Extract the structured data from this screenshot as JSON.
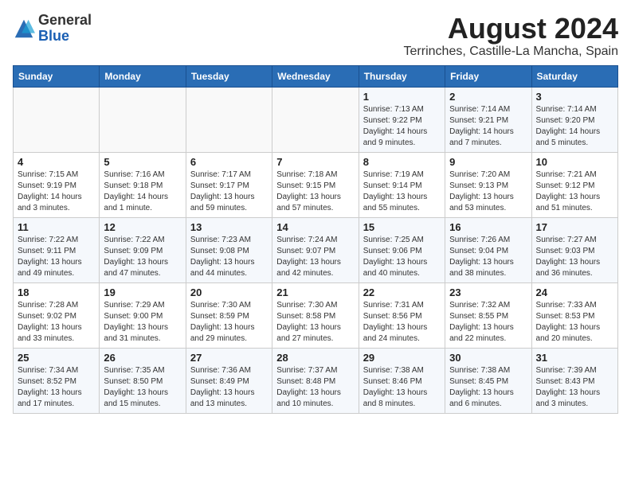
{
  "logo": {
    "general": "General",
    "blue": "Blue"
  },
  "title": "August 2024",
  "subtitle": "Terrinches, Castille-La Mancha, Spain",
  "headers": [
    "Sunday",
    "Monday",
    "Tuesday",
    "Wednesday",
    "Thursday",
    "Friday",
    "Saturday"
  ],
  "weeks": [
    [
      {
        "day": "",
        "info": ""
      },
      {
        "day": "",
        "info": ""
      },
      {
        "day": "",
        "info": ""
      },
      {
        "day": "",
        "info": ""
      },
      {
        "day": "1",
        "info": "Sunrise: 7:13 AM\nSunset: 9:22 PM\nDaylight: 14 hours\nand 9 minutes."
      },
      {
        "day": "2",
        "info": "Sunrise: 7:14 AM\nSunset: 9:21 PM\nDaylight: 14 hours\nand 7 minutes."
      },
      {
        "day": "3",
        "info": "Sunrise: 7:14 AM\nSunset: 9:20 PM\nDaylight: 14 hours\nand 5 minutes."
      }
    ],
    [
      {
        "day": "4",
        "info": "Sunrise: 7:15 AM\nSunset: 9:19 PM\nDaylight: 14 hours\nand 3 minutes."
      },
      {
        "day": "5",
        "info": "Sunrise: 7:16 AM\nSunset: 9:18 PM\nDaylight: 14 hours\nand 1 minute."
      },
      {
        "day": "6",
        "info": "Sunrise: 7:17 AM\nSunset: 9:17 PM\nDaylight: 13 hours\nand 59 minutes."
      },
      {
        "day": "7",
        "info": "Sunrise: 7:18 AM\nSunset: 9:15 PM\nDaylight: 13 hours\nand 57 minutes."
      },
      {
        "day": "8",
        "info": "Sunrise: 7:19 AM\nSunset: 9:14 PM\nDaylight: 13 hours\nand 55 minutes."
      },
      {
        "day": "9",
        "info": "Sunrise: 7:20 AM\nSunset: 9:13 PM\nDaylight: 13 hours\nand 53 minutes."
      },
      {
        "day": "10",
        "info": "Sunrise: 7:21 AM\nSunset: 9:12 PM\nDaylight: 13 hours\nand 51 minutes."
      }
    ],
    [
      {
        "day": "11",
        "info": "Sunrise: 7:22 AM\nSunset: 9:11 PM\nDaylight: 13 hours\nand 49 minutes."
      },
      {
        "day": "12",
        "info": "Sunrise: 7:22 AM\nSunset: 9:09 PM\nDaylight: 13 hours\nand 47 minutes."
      },
      {
        "day": "13",
        "info": "Sunrise: 7:23 AM\nSunset: 9:08 PM\nDaylight: 13 hours\nand 44 minutes."
      },
      {
        "day": "14",
        "info": "Sunrise: 7:24 AM\nSunset: 9:07 PM\nDaylight: 13 hours\nand 42 minutes."
      },
      {
        "day": "15",
        "info": "Sunrise: 7:25 AM\nSunset: 9:06 PM\nDaylight: 13 hours\nand 40 minutes."
      },
      {
        "day": "16",
        "info": "Sunrise: 7:26 AM\nSunset: 9:04 PM\nDaylight: 13 hours\nand 38 minutes."
      },
      {
        "day": "17",
        "info": "Sunrise: 7:27 AM\nSunset: 9:03 PM\nDaylight: 13 hours\nand 36 minutes."
      }
    ],
    [
      {
        "day": "18",
        "info": "Sunrise: 7:28 AM\nSunset: 9:02 PM\nDaylight: 13 hours\nand 33 minutes."
      },
      {
        "day": "19",
        "info": "Sunrise: 7:29 AM\nSunset: 9:00 PM\nDaylight: 13 hours\nand 31 minutes."
      },
      {
        "day": "20",
        "info": "Sunrise: 7:30 AM\nSunset: 8:59 PM\nDaylight: 13 hours\nand 29 minutes."
      },
      {
        "day": "21",
        "info": "Sunrise: 7:30 AM\nSunset: 8:58 PM\nDaylight: 13 hours\nand 27 minutes."
      },
      {
        "day": "22",
        "info": "Sunrise: 7:31 AM\nSunset: 8:56 PM\nDaylight: 13 hours\nand 24 minutes."
      },
      {
        "day": "23",
        "info": "Sunrise: 7:32 AM\nSunset: 8:55 PM\nDaylight: 13 hours\nand 22 minutes."
      },
      {
        "day": "24",
        "info": "Sunrise: 7:33 AM\nSunset: 8:53 PM\nDaylight: 13 hours\nand 20 minutes."
      }
    ],
    [
      {
        "day": "25",
        "info": "Sunrise: 7:34 AM\nSunset: 8:52 PM\nDaylight: 13 hours\nand 17 minutes."
      },
      {
        "day": "26",
        "info": "Sunrise: 7:35 AM\nSunset: 8:50 PM\nDaylight: 13 hours\nand 15 minutes."
      },
      {
        "day": "27",
        "info": "Sunrise: 7:36 AM\nSunset: 8:49 PM\nDaylight: 13 hours\nand 13 minutes."
      },
      {
        "day": "28",
        "info": "Sunrise: 7:37 AM\nSunset: 8:48 PM\nDaylight: 13 hours\nand 10 minutes."
      },
      {
        "day": "29",
        "info": "Sunrise: 7:38 AM\nSunset: 8:46 PM\nDaylight: 13 hours\nand 8 minutes."
      },
      {
        "day": "30",
        "info": "Sunrise: 7:38 AM\nSunset: 8:45 PM\nDaylight: 13 hours\nand 6 minutes."
      },
      {
        "day": "31",
        "info": "Sunrise: 7:39 AM\nSunset: 8:43 PM\nDaylight: 13 hours\nand 3 minutes."
      }
    ]
  ]
}
